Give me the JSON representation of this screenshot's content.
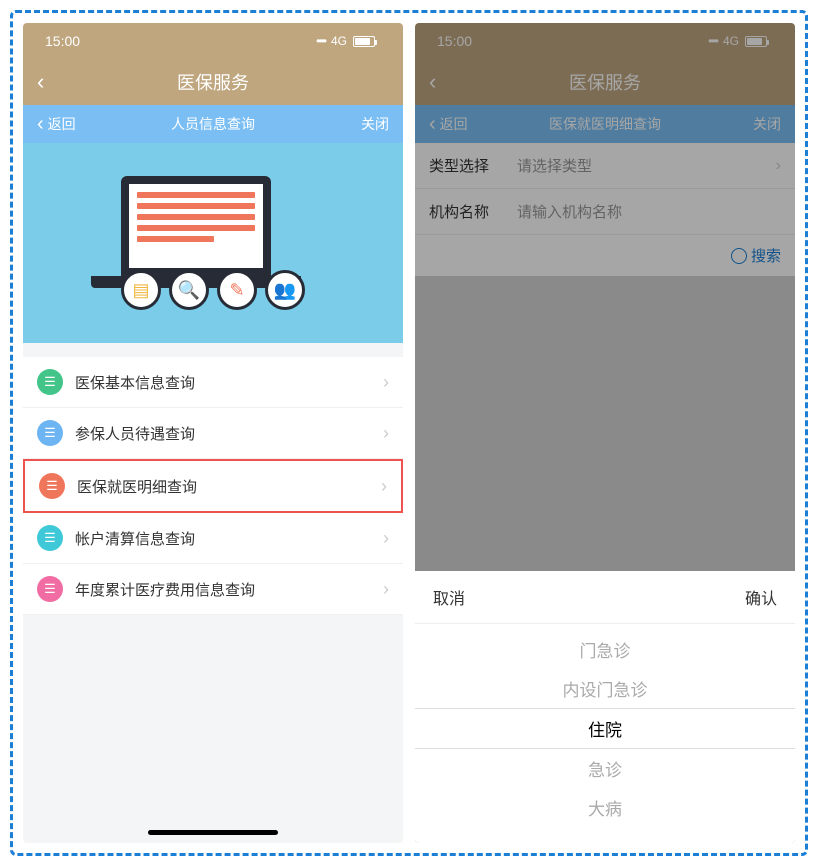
{
  "left": {
    "status": {
      "time": "15:00",
      "network": "4G"
    },
    "navMain": {
      "title": "医保服务"
    },
    "navSub": {
      "back": "返回",
      "title": "人员信息查询",
      "close": "关闭"
    },
    "menu": [
      {
        "label": "医保基本信息查询",
        "iconColor": "mi-green"
      },
      {
        "label": "参保人员待遇查询",
        "iconColor": "mi-blue"
      },
      {
        "label": "医保就医明细查询",
        "iconColor": "mi-orange",
        "highlight": true
      },
      {
        "label": "帐户清算信息查询",
        "iconColor": "mi-cyan"
      },
      {
        "label": "年度累计医疗费用信息查询",
        "iconColor": "mi-pink"
      }
    ]
  },
  "right": {
    "status": {
      "time": "15:00",
      "network": "4G"
    },
    "navMain": {
      "title": "医保服务"
    },
    "navSub": {
      "back": "返回",
      "title": "医保就医明细查询",
      "close": "关闭"
    },
    "form": {
      "typeLabel": "类型选择",
      "typePlaceholder": "请选择类型",
      "orgLabel": "机构名称",
      "orgPlaceholder": "请输入机构名称",
      "search": "搜索"
    },
    "picker": {
      "cancel": "取消",
      "confirm": "确认",
      "options": [
        "门急诊",
        "内设门急诊",
        "住院",
        "急诊",
        "大病"
      ],
      "selected": "住院"
    }
  }
}
